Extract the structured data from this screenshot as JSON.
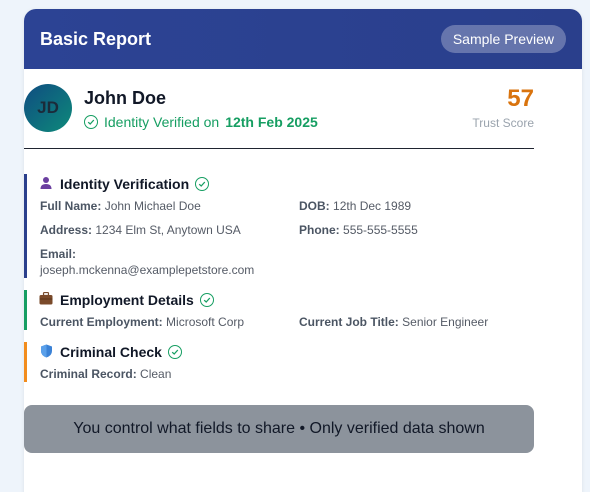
{
  "header": {
    "title": "Basic Report",
    "preview_label": "Sample Preview"
  },
  "profile": {
    "initials": "JD",
    "name": "John Doe",
    "verified_prefix": "Identity Verified on",
    "verified_date": "12th Feb 2025",
    "trust_score": "57",
    "trust_label": "Trust Score"
  },
  "identity": {
    "title": "Identity Verification",
    "icon": "person-icon",
    "full_name_label": "Full Name:",
    "full_name": "John Michael Doe",
    "dob_label": "DOB:",
    "dob": "12th Dec 1989",
    "address_label": "Address:",
    "address": "1234 Elm St, Anytown USA",
    "phone_label": "Phone:",
    "phone": "555-555-5555",
    "email_label": "Email:",
    "email": "joseph.mckenna@examplepetstore.com"
  },
  "employment": {
    "title": "Employment Details",
    "icon": "briefcase-icon",
    "current_employment_label": "Current Employment:",
    "current_employment": "Microsoft Corp",
    "job_title_label": "Current Job Title:",
    "job_title": "Senior Engineer"
  },
  "criminal": {
    "title": "Criminal Check",
    "icon": "shield-icon",
    "record_label": "Criminal Record:",
    "record": "Clean"
  },
  "footer": {
    "text": "You control what fields to share • Only verified data shown"
  },
  "colors": {
    "header": "#2c4394",
    "identity_bar": "#2a3f8c",
    "employment_bar": "#169e62",
    "criminal_bar": "#f28c1c",
    "verified": "#169e62",
    "trust": "#d9730d"
  }
}
